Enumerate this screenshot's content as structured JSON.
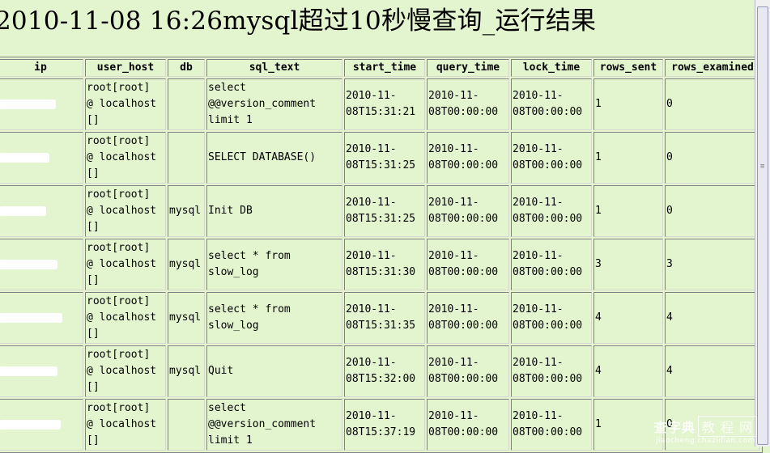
{
  "page": {
    "title": "2010-11-08 16:26mysql超过10秒慢查询_运行结果"
  },
  "table": {
    "columns": [
      "ip",
      "user_host",
      "db",
      "sql_text",
      "start_time",
      "query_time",
      "lock_time",
      "rows_sent",
      "rows_examined"
    ],
    "rows": [
      {
        "ip": "[redacted]",
        "user_host": "root[root]\n@ localhost\n[]",
        "db": "",
        "sql_text": "select\n@@version_comment\nlimit 1",
        "start_time": "2010-11-\n08T15:31:21",
        "query_time": "2010-11-\n08T00:00:00",
        "lock_time": "2010-11-\n08T00:00:00",
        "rows_sent": "1",
        "rows_examined": "0"
      },
      {
        "ip": "[redacted]",
        "user_host": "root[root]\n@ localhost\n[]",
        "db": "",
        "sql_text": "SELECT DATABASE()",
        "start_time": "2010-11-\n08T15:31:25",
        "query_time": "2010-11-\n08T00:00:00",
        "lock_time": "2010-11-\n08T00:00:00",
        "rows_sent": "1",
        "rows_examined": "0"
      },
      {
        "ip": "[redacted]",
        "user_host": "root[root]\n@ localhost\n[]",
        "db": "mysql",
        "sql_text": "Init DB",
        "start_time": "2010-11-\n08T15:31:25",
        "query_time": "2010-11-\n08T00:00:00",
        "lock_time": "2010-11-\n08T00:00:00",
        "rows_sent": "1",
        "rows_examined": "0"
      },
      {
        "ip": "[redacted]",
        "user_host": "root[root]\n@ localhost\n[]",
        "db": "mysql",
        "sql_text": "select * from\nslow_log",
        "start_time": "2010-11-\n08T15:31:30",
        "query_time": "2010-11-\n08T00:00:00",
        "lock_time": "2010-11-\n08T00:00:00",
        "rows_sent": "3",
        "rows_examined": "3"
      },
      {
        "ip": "[redacted]",
        "user_host": "root[root]\n@ localhost\n[]",
        "db": "mysql",
        "sql_text": "select * from\nslow_log",
        "start_time": "2010-11-\n08T15:31:35",
        "query_time": "2010-11-\n08T00:00:00",
        "lock_time": "2010-11-\n08T00:00:00",
        "rows_sent": "4",
        "rows_examined": "4"
      },
      {
        "ip": "[redacted]",
        "user_host": "root[root]\n@ localhost\n[]",
        "db": "mysql",
        "sql_text": "Quit",
        "start_time": "2010-11-\n08T15:32:00",
        "query_time": "2010-11-\n08T00:00:00",
        "lock_time": "2010-11-\n08T00:00:00",
        "rows_sent": "4",
        "rows_examined": "4"
      },
      {
        "ip": "[redacted]",
        "user_host": "root[root]\n@ localhost\n[]",
        "db": "",
        "sql_text": "select\n@@version_comment\nlimit 1",
        "start_time": "2010-11-\n08T15:37:19",
        "query_time": "2010-11-\n08T00:00:00",
        "lock_time": "2010-11-\n08T00:00:00",
        "rows_sent": "1",
        "rows_examined": "0"
      }
    ]
  },
  "watermark": {
    "main": "查字典",
    "box": "教 程 网",
    "sub": "jiaocheng.chazidian.com"
  },
  "colors": {
    "background": "#e3f5cf",
    "border": "#808080"
  }
}
